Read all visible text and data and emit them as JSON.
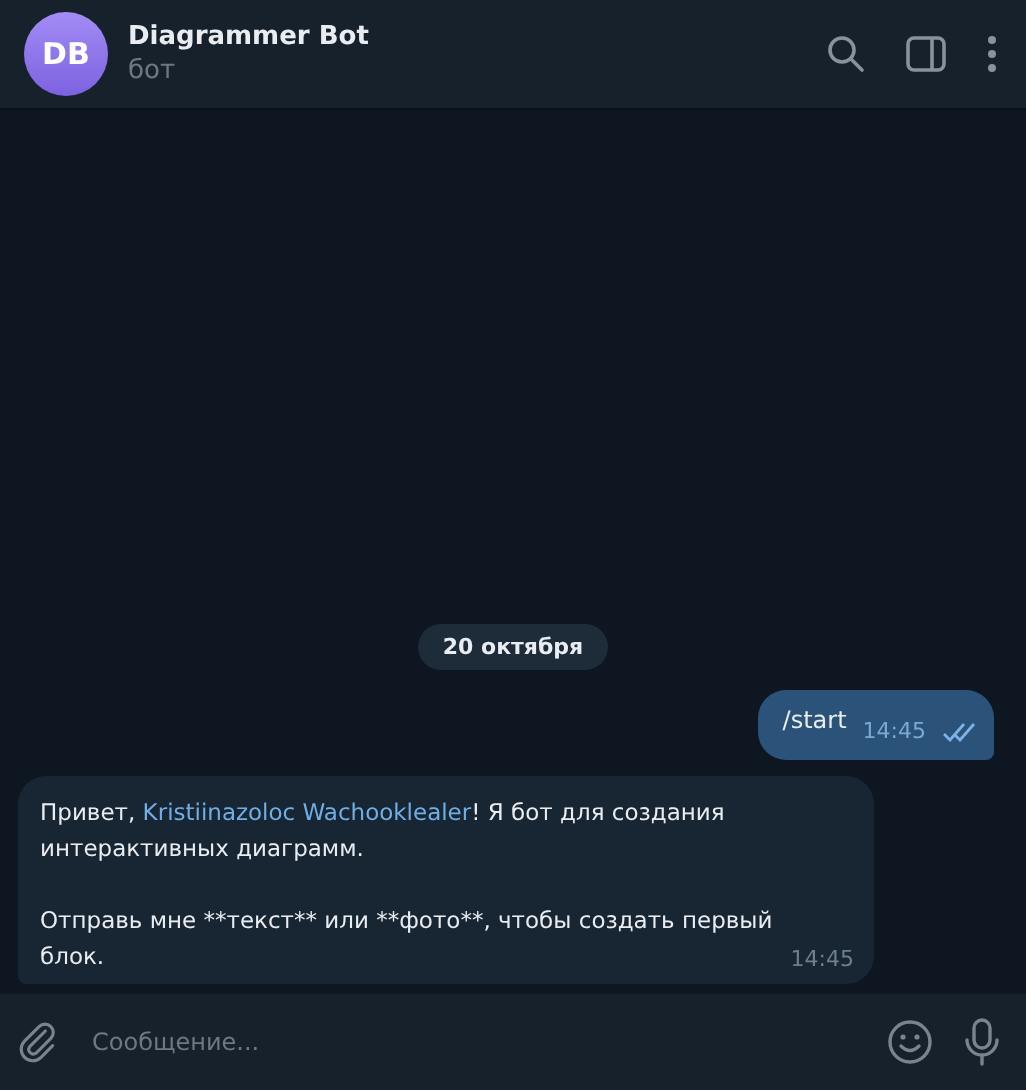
{
  "header": {
    "avatar_initials": "DB",
    "title": "Diagrammer Bot",
    "subtitle": "бот"
  },
  "date_badge": "20 октября",
  "messages": [
    {
      "kind": "outgoing",
      "text": "/start",
      "time": "14:45",
      "read": true
    },
    {
      "kind": "incoming",
      "text_before": "Привет, ",
      "mention": "Kristiinazoloc Wachooklealer",
      "text_after": "! Я бот для создания интерактивных диаграмм.",
      "second_paragraph": "Отправь мне **текст** или **фото**, чтобы создать первый блок.",
      "time": "14:45"
    }
  ],
  "composer": {
    "placeholder": "Сообщение..."
  }
}
